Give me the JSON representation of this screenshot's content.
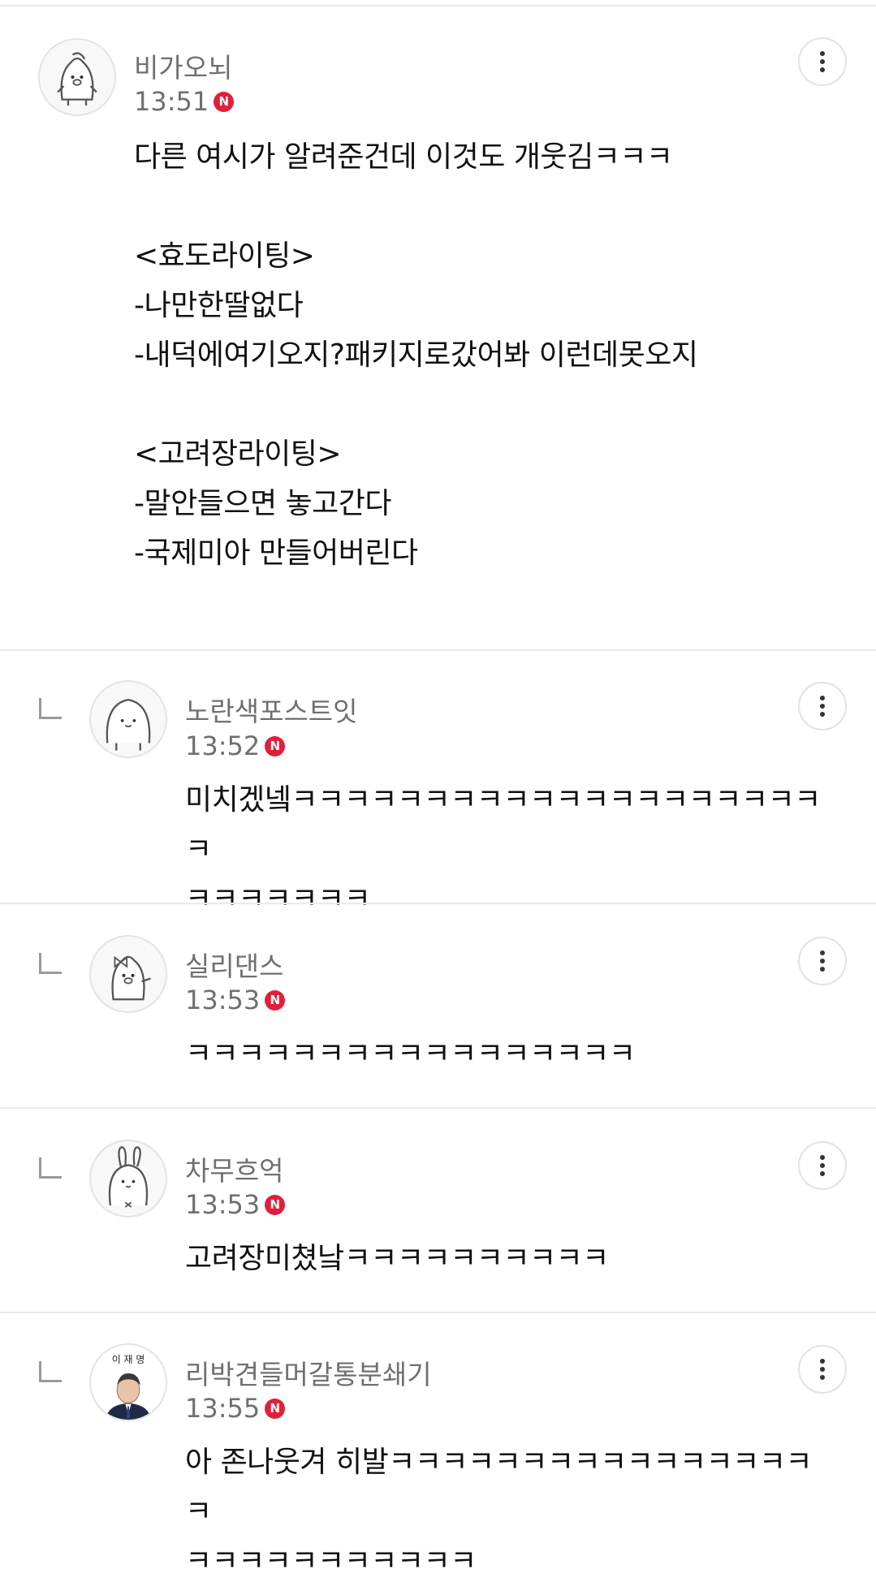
{
  "comments": [
    {
      "name": "비가오뇌",
      "time": "13:51",
      "badge": "N",
      "text": "다른 여시가 알려준건데 이것도 개웃김ㅋㅋㅋ\n\n<효도라이팅>\n-나만한딸없다\n-내덕에여기오지?패키지로갔어봐 이런데못오지\n\n<고려장라이팅>\n-말안들으면 놓고간다\n-국제미아 만들어버린다",
      "avatar_icon": "penguin-avatar-icon"
    },
    {
      "name": "노란색포스트잇",
      "time": "13:52",
      "badge": "N",
      "text": "미치겠넼ㅋㅋㅋㅋㅋㅋㅋㅋㅋㅋㅋㅋㅋㅋㅋㅋㅋㅋㅋㅋㅋ\nㅋㅋㅋㅋㅋㅋㅋ",
      "avatar_icon": "blob-avatar-icon"
    },
    {
      "name": "실리댄스",
      "time": "13:53",
      "badge": "N",
      "text": "ㅋㅋㅋㅋㅋㅋㅋㅋㅋㅋㅋㅋㅋㅋㅋㅋㅋ",
      "avatar_icon": "penguin-bow-avatar-icon"
    },
    {
      "name": "차무흐억",
      "time": "13:53",
      "badge": "N",
      "text": "고려장미쳤낰ㅋㅋㅋㅋㅋㅋㅋㅋㅋㅋ",
      "avatar_icon": "rabbit-avatar-icon"
    },
    {
      "name": "리박견들머갈통분쇄기",
      "time": "13:55",
      "badge": "N",
      "text": "아 존나웃겨 히발ㅋㅋㅋㅋㅋㅋㅋㅋㅋㅋㅋㅋㅋㅋㅋㅋㅋ\nㅋㅋㅋㅋㅋㅋㅋㅋㅋㅋㅋ",
      "avatar_icon": "portrait-avatar-icon",
      "avatar_caption": "이 재 명"
    }
  ],
  "icons": {
    "more": "more-vertical-icon",
    "reply": "reply-arrow-icon"
  },
  "colors": {
    "badge": "#e0203a",
    "meta": "#6f6f6f",
    "divider": "#ebebeb"
  }
}
